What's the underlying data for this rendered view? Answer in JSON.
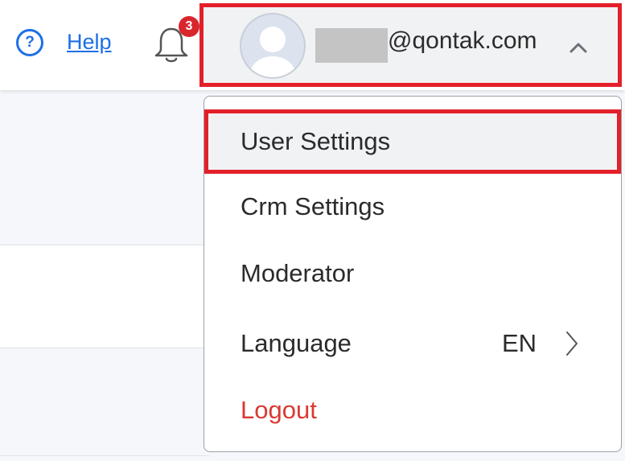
{
  "header": {
    "help_label": "Help",
    "help_icon": "?",
    "notification_count": "3",
    "account": {
      "email_suffix": "@qontak.com"
    }
  },
  "account_menu": {
    "items": [
      {
        "label": "User Settings"
      },
      {
        "label": "Crm Settings"
      },
      {
        "label": "Moderator"
      },
      {
        "label": "Language",
        "value": "EN"
      },
      {
        "label": "Logout"
      }
    ]
  },
  "colors": {
    "accent": "#1d6fe5",
    "highlight_border": "#e3202a",
    "badge": "#d9262d",
    "logout": "#d83a32"
  }
}
